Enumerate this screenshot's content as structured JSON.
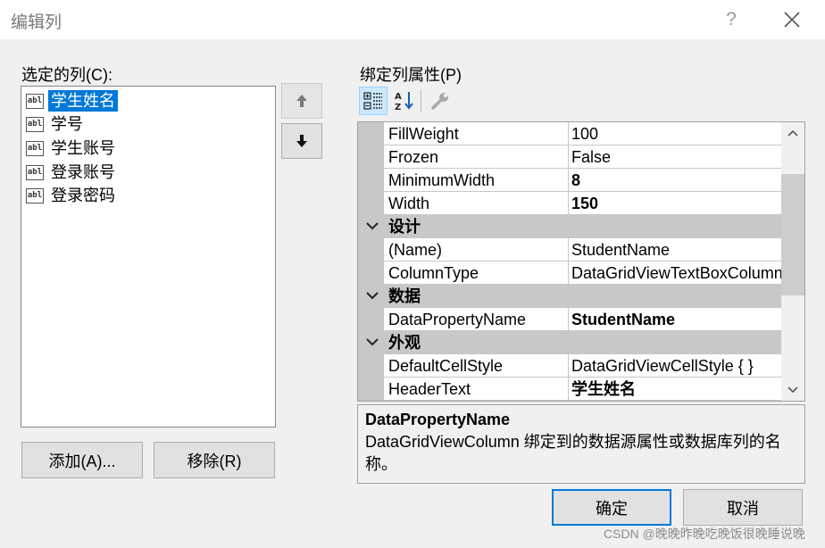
{
  "dialog": {
    "title": "编辑列",
    "help_symbol": "?"
  },
  "left": {
    "label": "选定的列(C):",
    "icon_text": "abl",
    "columns": [
      {
        "label": "学生姓名",
        "selected": true
      },
      {
        "label": "学号",
        "selected": false
      },
      {
        "label": "学生账号",
        "selected": false
      },
      {
        "label": "登录账号",
        "selected": false
      },
      {
        "label": "登录密码",
        "selected": false
      }
    ],
    "add_label": "添加(A)...",
    "remove_label": "移除(R)"
  },
  "right": {
    "label": "绑定列属性(P)",
    "rows": [
      {
        "type": "prop",
        "name": "FillWeight",
        "value": "100",
        "bold": false
      },
      {
        "type": "prop",
        "name": "Frozen",
        "value": "False",
        "bold": false
      },
      {
        "type": "prop",
        "name": "MinimumWidth",
        "value": "8",
        "bold": true
      },
      {
        "type": "prop",
        "name": "Width",
        "value": "150",
        "bold": true
      },
      {
        "type": "category",
        "name": "设计"
      },
      {
        "type": "prop",
        "name": "(Name)",
        "value": "StudentName",
        "bold": false
      },
      {
        "type": "prop",
        "name": "ColumnType",
        "value": "DataGridViewTextBoxColumn",
        "bold": false
      },
      {
        "type": "category",
        "name": "数据"
      },
      {
        "type": "prop",
        "name": "DataPropertyName",
        "value": "StudentName",
        "bold": true
      },
      {
        "type": "category",
        "name": "外观"
      },
      {
        "type": "prop",
        "name": "DefaultCellStyle",
        "value": "DataGridViewCellStyle { }",
        "bold": false
      },
      {
        "type": "prop",
        "name": "HeaderText",
        "value": "学生姓名",
        "bold": true
      }
    ],
    "help_title": "DataPropertyName",
    "help_desc": "DataGridViewColumn 绑定到的数据源属性或数据库列的名称。"
  },
  "footer": {
    "ok_label": "确定",
    "cancel_label": "取消"
  },
  "watermark": "CSDN @晚晚昨晚吃晚饭很晚睡说晚",
  "colors": {
    "accent": "#0078d7",
    "category_bg": "#c8c8c8",
    "dialog_bg": "#f0f0f0"
  }
}
